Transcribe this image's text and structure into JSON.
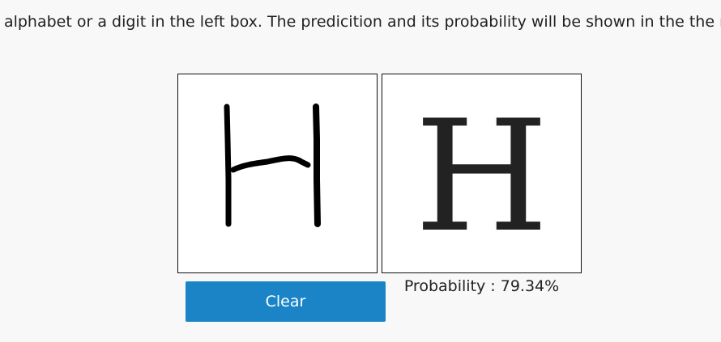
{
  "instructions": "aw an alphabet or a digit in the left box. The predicition and its probability will be shown in the the rig",
  "canvas": {
    "stroke_color": "#000000"
  },
  "prediction": {
    "character": "H",
    "probability_label": "Probability : 79.34%"
  },
  "controls": {
    "clear_label": "Clear",
    "button_color": "#1b84c7"
  }
}
